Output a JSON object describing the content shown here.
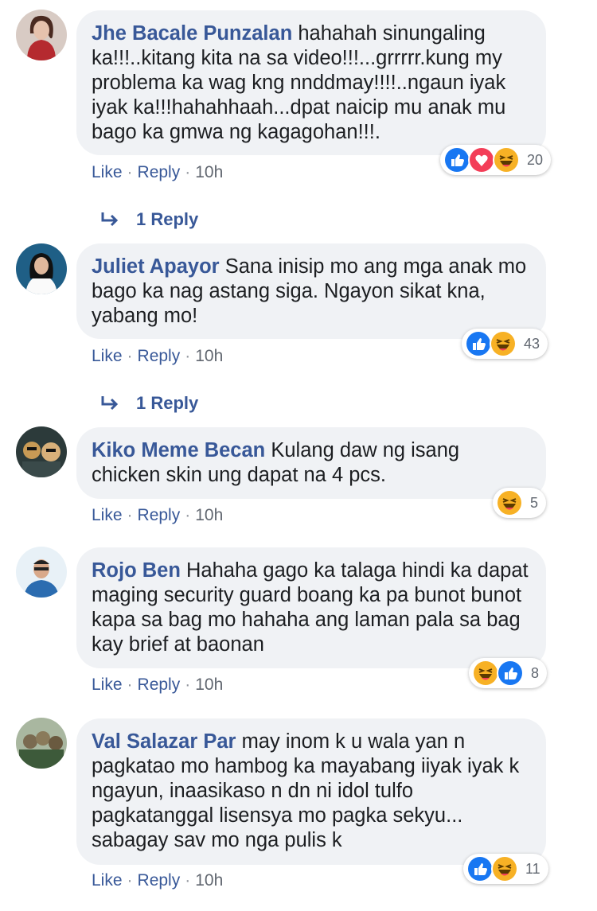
{
  "actions": {
    "like": "Like",
    "reply": "Reply",
    "sep": "·"
  },
  "comments": [
    {
      "author": "Jhe Bacale Punzalan",
      "text": "hahahah sinungaling ka!!!..kitang kita na sa video!!!...grrrrr.kung my problema ka wag kng nnddmay!!!!..ngaun iyak iyak ka!!!hahahhaah...dpat naicip mu anak mu bago ka gmwa ng kagagohan!!!.",
      "time": "10h",
      "reaction_count": "20",
      "reactions": [
        "like",
        "love",
        "haha"
      ],
      "replies": "1 Reply",
      "avatar_colors": [
        "#c9b8b0",
        "#b52a2f"
      ]
    },
    {
      "author": "Juliet Apayor",
      "text": "Sana inisip mo ang mga anak mo bago ka nag astang siga. Ngayon sikat kna, yabang mo!",
      "time": "10h",
      "reaction_count": "43",
      "reactions": [
        "like",
        "haha"
      ],
      "replies": "1 Reply",
      "avatar_colors": [
        "#1f5f86",
        "#111111"
      ]
    },
    {
      "author": "Kiko Meme Becan",
      "text": "Kulang daw ng isang chicken skin ung dapat na 4 pcs.",
      "time": "10h",
      "reaction_count": "5",
      "reactions": [
        "haha"
      ],
      "avatar_colors": [
        "#2c3a3a",
        "#c89a55"
      ]
    },
    {
      "author": "Rojo Ben",
      "text": "Hahaha gago ka talaga hindi ka dapat maging security guard boang ka pa bunot bunot kapa sa bag mo hahaha ang laman pala sa bag kay brief at baonan",
      "time": "10h",
      "reaction_count": "8",
      "reactions": [
        "haha",
        "like"
      ],
      "avatar_colors": [
        "#cfe3f0",
        "#2b6cb0"
      ]
    },
    {
      "author": "Val Salazar Par",
      "text": "may inom k u wala yan n pagkatao mo hambog ka mayabang iiyak iyak k ngayun, inaasikaso n dn ni idol tulfo pagkatanggal lisensya mo pagka sekyu... sabagay sav mo nga pulis k",
      "time": "10h",
      "reaction_count": "11",
      "reactions": [
        "like",
        "haha"
      ],
      "avatar_colors": [
        "#3d5a3a",
        "#a9b7a0"
      ]
    }
  ],
  "colors": {
    "link": "#385898",
    "bubble": "#f0f2f5",
    "like": "#1877f2",
    "love": "#f33e58",
    "haha": "#f7b125"
  }
}
